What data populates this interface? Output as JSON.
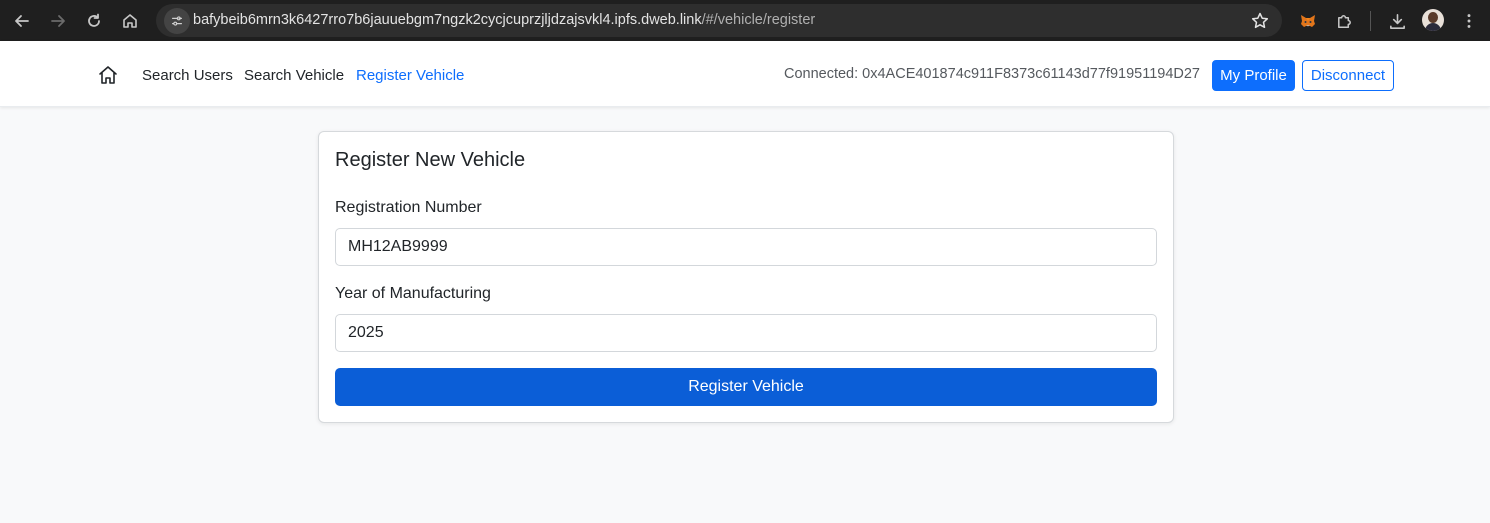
{
  "browser": {
    "url_main": "bafybeib6mrn3k6427rro7b6jauuebgm7ngzk2cycjcuprzjljdzajsvkl4.ipfs.dweb.link",
    "url_path": "/#/vehicle/register",
    "icons": [
      "back-icon",
      "forward-icon",
      "reload-icon",
      "home-icon",
      "site-info-icon",
      "bookmark-star-icon",
      "metamask-fox-icon",
      "extensions-puzzle-icon",
      "download-icon",
      "profile-avatar",
      "more-menu-icon"
    ]
  },
  "navbar": {
    "home_icon": "home-icon",
    "links": [
      {
        "label": "Search Users",
        "active": false
      },
      {
        "label": "Search Vehicle",
        "active": false
      },
      {
        "label": "Register Vehicle",
        "active": true
      }
    ],
    "connected_text": "Connected: 0x4ACE401874c911F8373c61143d77f91951194D27",
    "my_profile_label": "My Profile",
    "disconnect_label": "Disconnect"
  },
  "form": {
    "title": "Register New Vehicle",
    "registration_label": "Registration Number",
    "registration_value": "MH12AB9999",
    "year_label": "Year of Manufacturing",
    "year_value": "2025",
    "submit_label": "Register Vehicle"
  },
  "colors": {
    "primary": "#0d6efd",
    "submit": "#0b5ed7",
    "page_bg": "#f8f9fa",
    "browser_bg": "#1f1f1f"
  }
}
